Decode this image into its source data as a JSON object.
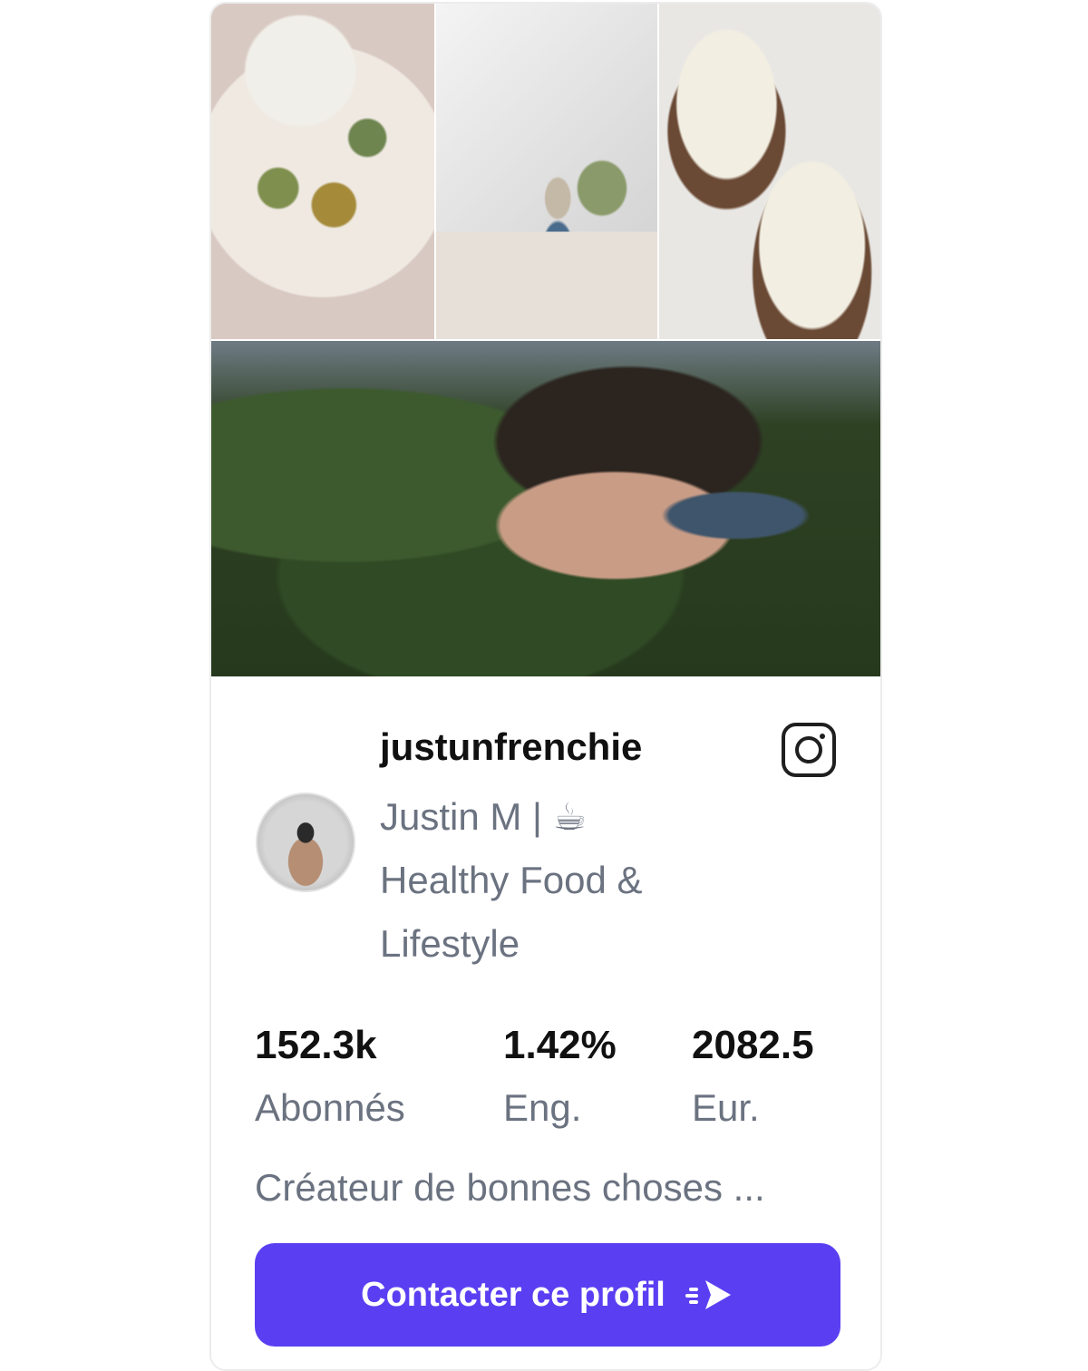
{
  "profile": {
    "username": "justunfrenchie",
    "bio_line1": "Justin M | ☕",
    "bio_line2": "Healthy Food &",
    "bio_line3": "Lifestyle",
    "description": "Créateur de bonnes choses ..."
  },
  "stats": [
    {
      "value": "152.3k",
      "label": "Abonnés"
    },
    {
      "value": "1.42%",
      "label": "Eng."
    },
    {
      "value": "2082.5",
      "label": "Eur."
    }
  ],
  "cta": {
    "label": "Contacter ce profil"
  },
  "colors": {
    "accent": "#5a3ff2",
    "muted_text": "#6b7280",
    "strong_text": "#111111"
  },
  "icons": {
    "platform": "instagram-icon",
    "cta": "send-arrow-icon"
  }
}
